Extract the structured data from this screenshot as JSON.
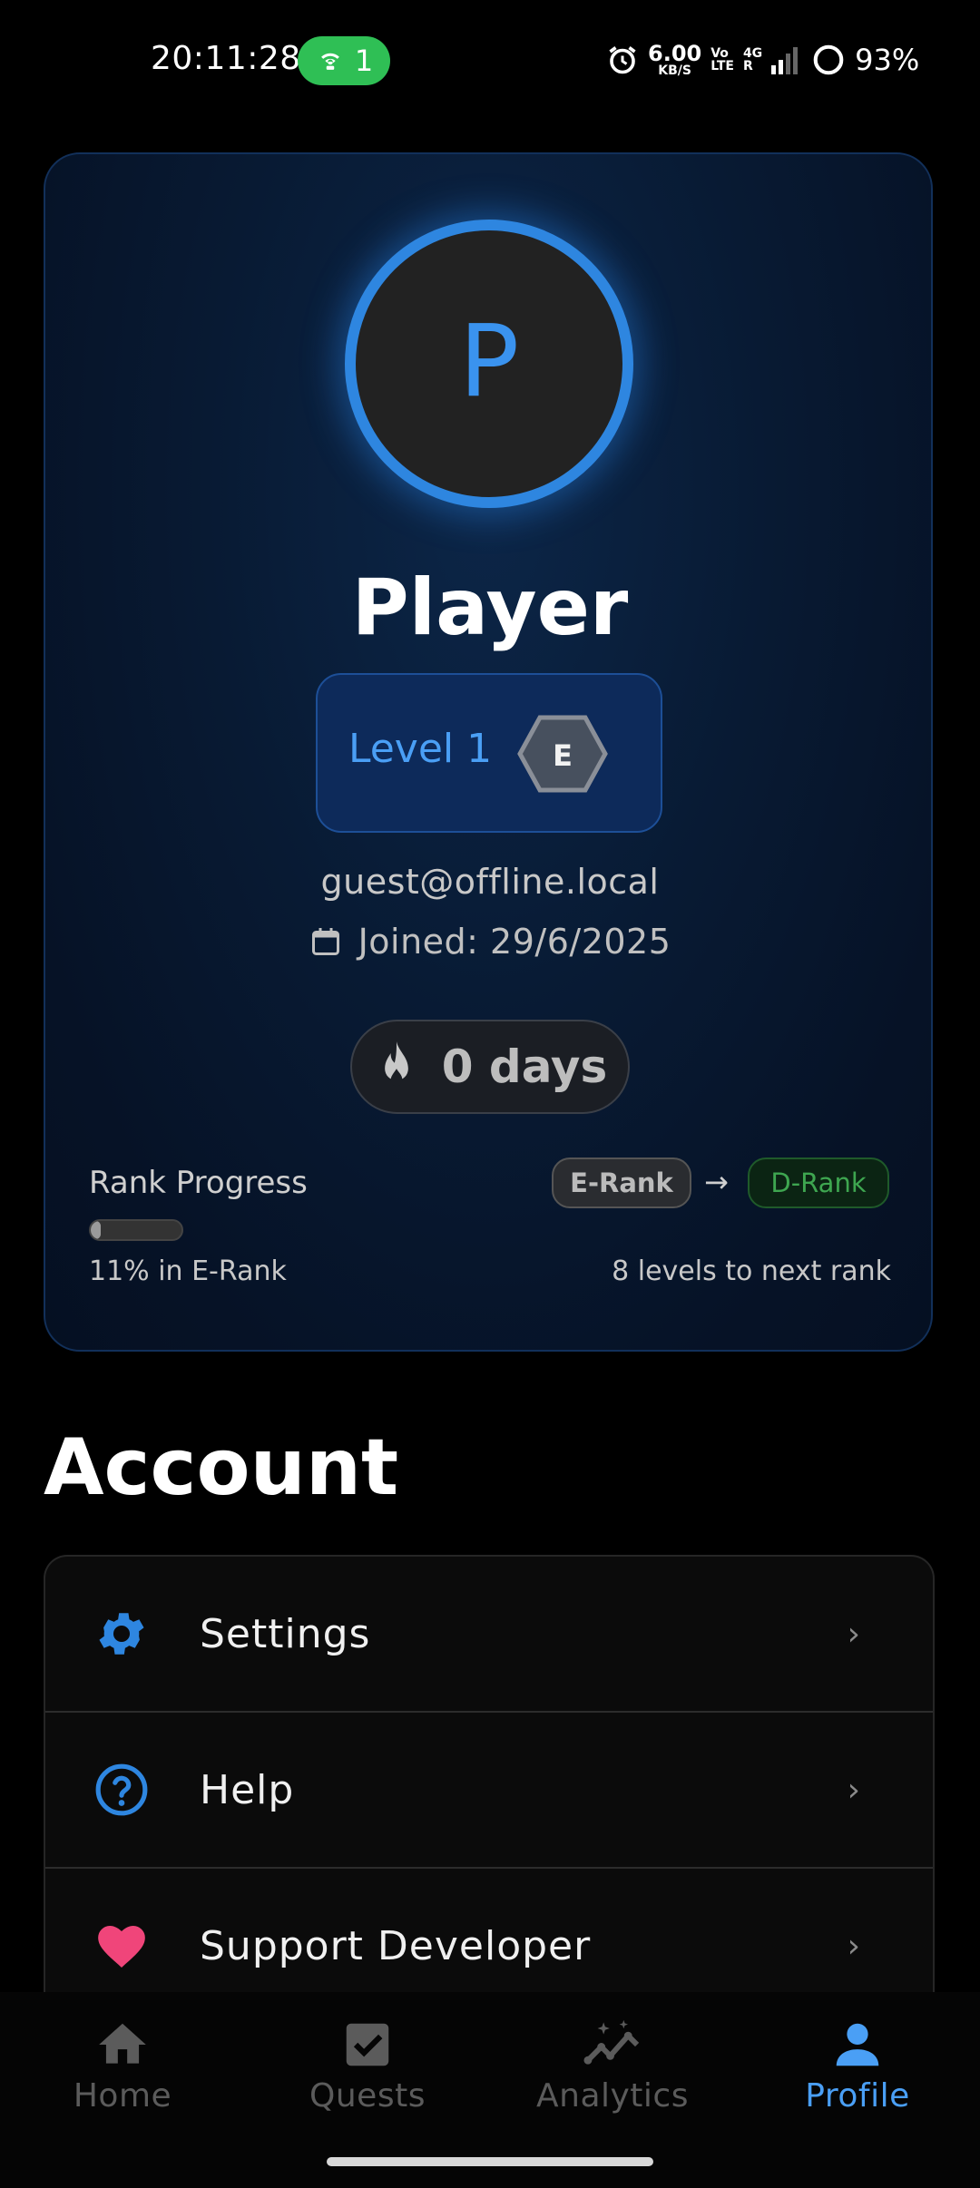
{
  "status_bar": {
    "time": "20:11:28",
    "hotspot_count": "1",
    "net_speed_value": "6.00",
    "net_speed_unit": "KB/S",
    "volte_top": "Vo",
    "volte_bottom": "LTE",
    "network_top": "4G",
    "network_bottom": "R",
    "battery": "93%",
    "hotspot_color": "#2fbf55"
  },
  "profile": {
    "avatar_letter": "P",
    "name": "Player",
    "level_label": "Level 1",
    "rank_letter": "E",
    "email": "guest@offline.local",
    "joined": "Joined: 29/6/2025",
    "streak": "0 days",
    "accent_color": "#2e86e0"
  },
  "rank_progress": {
    "label": "Rank Progress",
    "current_rank": "E-Rank",
    "arrow": "→",
    "next_rank": "D-Rank",
    "progress_percent": 11,
    "progress_text": "11% in E-Rank",
    "remaining_text": "8 levels to next rank"
  },
  "account": {
    "title": "Account",
    "items": [
      {
        "label": "Settings",
        "icon": "gear-icon",
        "icon_color": "#2e86e0"
      },
      {
        "label": "Help",
        "icon": "help-circle-icon",
        "icon_color": "#2e86e0"
      },
      {
        "label": "Support Developer",
        "icon": "heart-icon",
        "icon_color": "#f0457a"
      }
    ],
    "chevron": "›"
  },
  "bottom_nav": {
    "items": [
      {
        "label": "Home",
        "icon": "home-icon",
        "active": false
      },
      {
        "label": "Quests",
        "icon": "checkbox-icon",
        "active": false
      },
      {
        "label": "Analytics",
        "icon": "analytics-icon",
        "active": false
      },
      {
        "label": "Profile",
        "icon": "person-icon",
        "active": true
      }
    ],
    "active_color": "#4a9ff5",
    "inactive_color": "#5b5b5b"
  }
}
